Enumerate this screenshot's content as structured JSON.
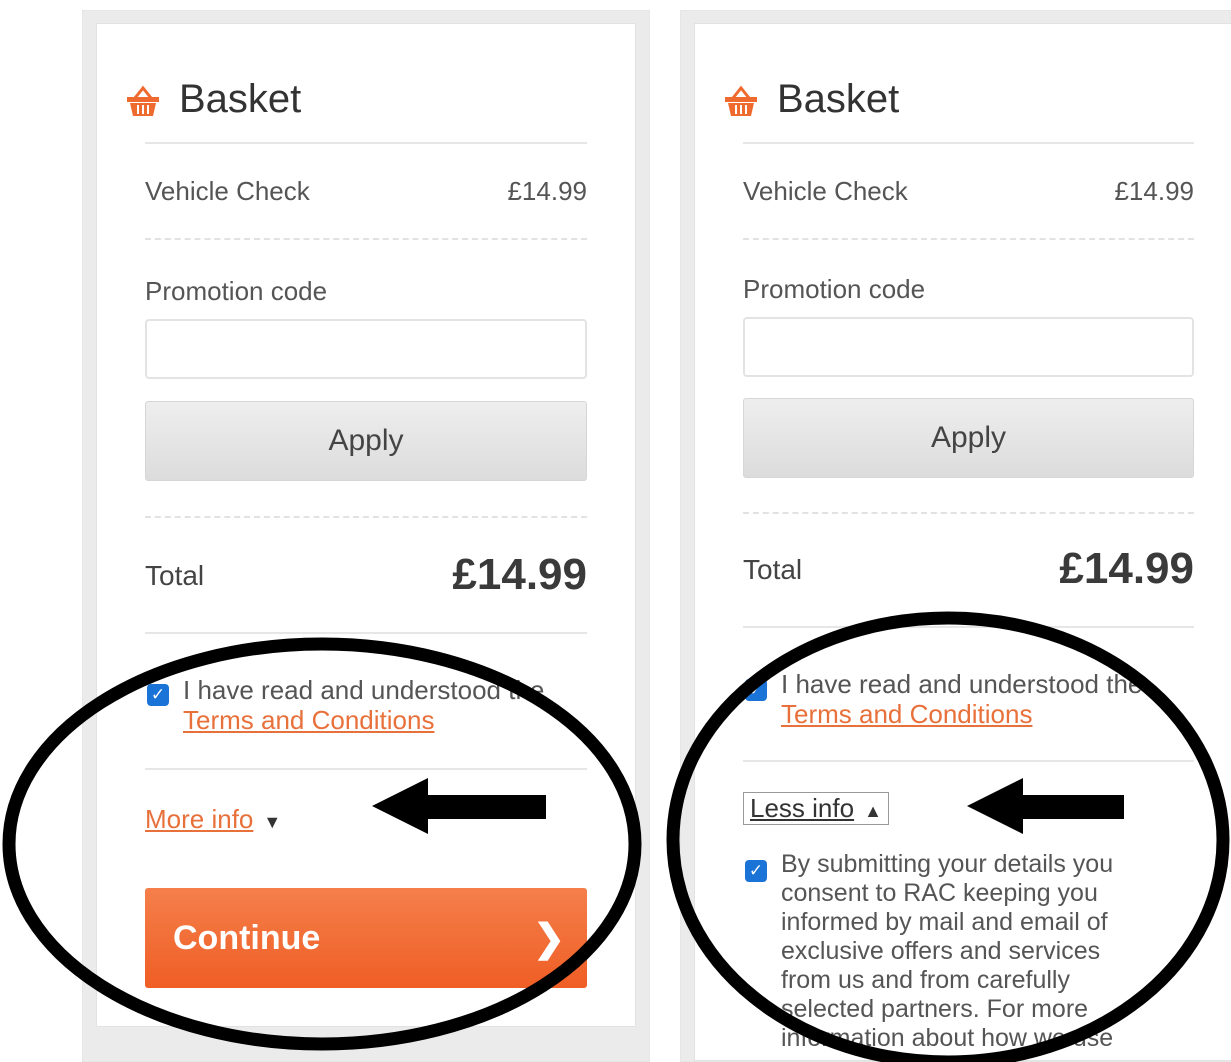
{
  "left": {
    "header_title": "Basket",
    "item_name": "Vehicle Check",
    "item_price": "£14.99",
    "promo_label": "Promotion code",
    "promo_value": "",
    "apply_label": "Apply",
    "total_label": "Total",
    "total_value": "£14.99",
    "terms_text": "I have read and understood the",
    "terms_link": "Terms and Conditions",
    "terms_checked": true,
    "more_info_label": "More info",
    "continue_label": "Continue"
  },
  "right": {
    "header_title": "Basket",
    "item_name": "Vehicle Check",
    "item_price": "£14.99",
    "promo_label": "Promotion code",
    "promo_value": "",
    "apply_label": "Apply",
    "total_label": "Total",
    "total_value": "£14.99",
    "terms_text": "I have read and understood the",
    "terms_link": "Terms and Conditions",
    "terms_checked": true,
    "less_info_label": "Less info",
    "consent_checked": true,
    "consent_text": "By submitting your details you consent to RAC keeping you informed by mail and email of exclusive offers and services from us and from carefully selected partners. For more information about how we use"
  },
  "colors": {
    "accent_orange": "#ef5e25",
    "link_orange": "#e8703a",
    "checkbox_blue": "#1a73d6",
    "annotation_black": "#000000"
  },
  "icons": {
    "basket": "basket-icon",
    "caret_down": "caret-down-icon",
    "caret_up": "caret-up-icon",
    "chevron_right": "chevron-right-icon",
    "checkmark": "checkmark-icon"
  }
}
